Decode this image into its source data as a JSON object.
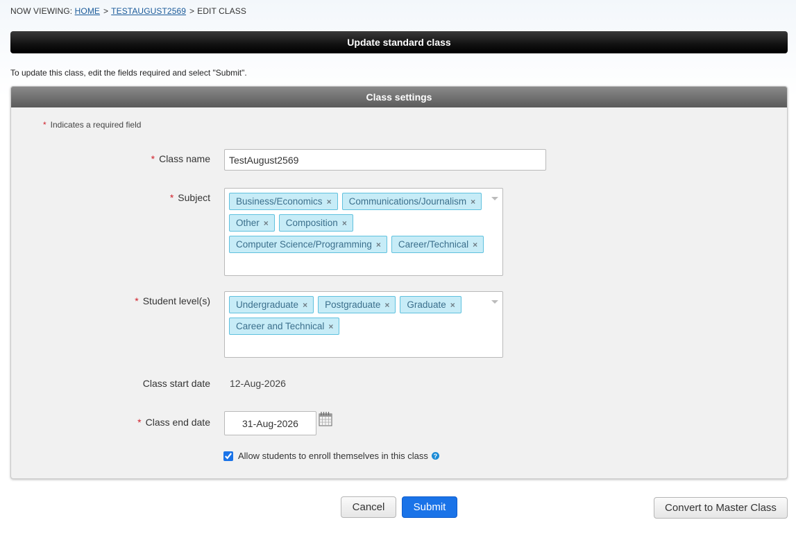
{
  "breadcrumb": {
    "prefix": "NOW VIEWING:",
    "home": "HOME",
    "class_link": "TESTAUGUST2569",
    "current": "EDIT CLASS",
    "separator": ">"
  },
  "page_title": "Update standard class",
  "instructions": "To update this class, edit the fields required and select \"Submit\".",
  "panel": {
    "title": "Class settings",
    "required_star": "*",
    "required_note": "Indicates a required field"
  },
  "form": {
    "class_name": {
      "label": "Class name",
      "value": "TestAugust2569"
    },
    "subject": {
      "label": "Subject",
      "rows": [
        [
          "Business/Economics",
          "Communications/Journalism"
        ],
        [
          "Other",
          "Composition"
        ],
        [
          "Computer Science/Programming",
          "Career/Technical"
        ]
      ]
    },
    "student_levels": {
      "label": "Student level(s)",
      "rows": [
        [
          "Undergraduate",
          "Postgraduate",
          "Graduate"
        ],
        [
          "Career and Technical"
        ]
      ]
    },
    "start_date": {
      "label": "Class start date",
      "value": "12-Aug-2026"
    },
    "end_date": {
      "label": "Class end date",
      "value": "31-Aug-2026"
    },
    "self_enroll": {
      "label": "Allow students to enroll themselves in this class",
      "checked": true
    },
    "remove_glyph": "×",
    "help_glyph": "?"
  },
  "buttons": {
    "cancel": "Cancel",
    "submit": "Submit",
    "convert": "Convert to Master Class"
  }
}
